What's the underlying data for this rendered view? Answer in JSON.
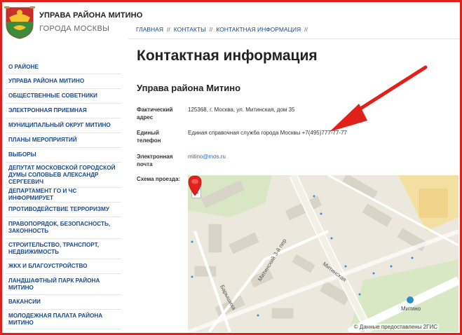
{
  "header": {
    "title": "УПРАВА РАЙОНА МИТИНО",
    "subtitle": "ГОРОДА МОСКВЫ"
  },
  "breadcrumb": [
    "ГЛАВНАЯ",
    "КОНТАКТЫ",
    "КОНТАКТНАЯ ИНФОРМАЦИЯ"
  ],
  "breadcrumb_sep": "//",
  "sidebar": {
    "items": [
      {
        "label": "О РАЙОНЕ"
      },
      {
        "label": "УПРАВА РАЙОНА МИТИНО"
      },
      {
        "label": "ОБЩЕСТВЕННЫЕ СОВЕТНИКИ"
      },
      {
        "label": "ЭЛЕКТРОННАЯ ПРИЕМНАЯ"
      },
      {
        "label": "МУНИЦИПАЛЬНЫЙ ОКРУГ МИТИНО"
      },
      {
        "label": "ПЛАНЫ МЕРОПРИЯТИЙ"
      },
      {
        "label": "ВЫБОРЫ"
      },
      {
        "label": "ДЕПУТАТ МОСКОВСКОЙ ГОРОДСКОЙ ДУМЫ СОЛОВЬЕВ АЛЕКСАНДР СЕРГЕЕВИЧ"
      },
      {
        "label": "ДЕПАРТАМЕНТ ГО И ЧС ИНФОРМИРУЕТ"
      },
      {
        "label": "ПРОТИВОДЕЙСТВИЕ ТЕРРОРИЗМУ"
      },
      {
        "label": "ПРАВОПОРЯДОК, БЕЗОПАСНОСТЬ, ЗАКОННОСТЬ"
      },
      {
        "label": "СТРОИТЕЛЬСТВО, ТРАНСПОРТ, НЕДВИЖИМОСТЬ"
      },
      {
        "label": "ЖКХ И БЛАГОУСТРОЙСТВО"
      },
      {
        "label": "ЛАНДШАФТНЫЙ ПАРК РАЙОНА МИТИНО"
      },
      {
        "label": "ВАКАНСИИ"
      },
      {
        "label": "МОЛОДЕЖНАЯ ПАЛАТА РАЙОНА МИТИНО"
      }
    ]
  },
  "main": {
    "page_title": "Контактная информация",
    "org_title": "Управа района Митино",
    "address_label": "Фактический адрес",
    "address_value": "125368, г. Москва, ул. Митинская, дом 35",
    "phone_label": "Единый телефон",
    "phone_value": "Единая справочная служба города Москвы +7(495)777-77-77",
    "email_label": "Электронная почта",
    "email_value": "mitino@mos.ru",
    "map_label": "Схема проезда:"
  },
  "map": {
    "zoom_in": "+",
    "zoom_out": "−",
    "credit": "© Данные предоставлены 2ГИС",
    "street_1": "Митинская",
    "street_2": "Митинский 3-й пер",
    "street_3": "Барышиха",
    "metro": "Митино"
  },
  "colors": {
    "frame": "#e0201b",
    "link": "#1b4a8c",
    "arrow": "#e0201b",
    "pin": "#e3201b"
  }
}
